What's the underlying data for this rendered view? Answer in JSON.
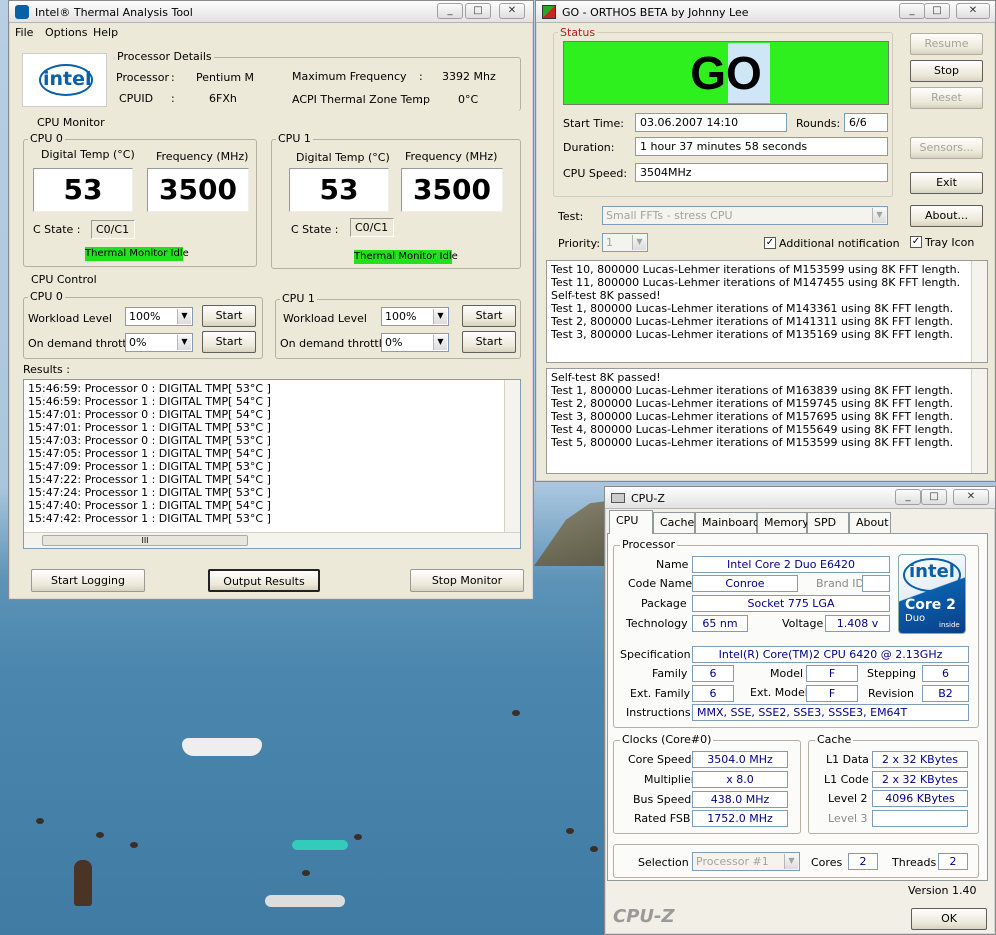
{
  "itat": {
    "title": "Intel® Thermal Analysis Tool",
    "menu": [
      "File",
      "Options",
      "Help"
    ],
    "processor_details_label": "Processor Details",
    "brand": "intel",
    "processor_label": "Processor",
    "processor_value": "Pentium M",
    "cpuid_label": "CPUID",
    "cpuid_value": "6FXh",
    "maxfreq_label": "Maximum Frequency",
    "maxfreq_value": "3392 Mhz",
    "acpi_label": "ACPI Thermal Zone Temp",
    "acpi_value": "0°C",
    "colon": ":",
    "cpu_monitor_label": "CPU Monitor",
    "cpus": [
      {
        "label": "CPU 0",
        "temp_label": "Digital Temp (°C)",
        "freq_label": "Frequency (MHz)",
        "temp": "53",
        "freq": "3500",
        "cstate_label": "C State  :",
        "cstate": "C0/C1",
        "status": "Thermal Monitor Idle"
      },
      {
        "label": "CPU 1",
        "temp_label": "Digital Temp (°C)",
        "freq_label": "Frequency (MHz)",
        "temp": "53",
        "freq": "3500",
        "cstate_label": "C State  :",
        "cstate": "C0/C1",
        "status": "Thermal Monitor Idle"
      }
    ],
    "cpu_control_label": "CPU Control",
    "controls": [
      {
        "label": "CPU 0",
        "workload_label": "Workload  Level",
        "workload": "100%",
        "throttle_label": "On demand throttle",
        "throttle": "0%",
        "start1": "Start",
        "start2": "Start"
      },
      {
        "label": "CPU 1",
        "workload_label": "Workload  Level",
        "workload": "100%",
        "throttle_label": "On demand throttle",
        "throttle": "0%",
        "start1": "Start",
        "start2": "Start"
      }
    ],
    "results_label": "Results :",
    "results": [
      "15:46:59: Processor 0 : DIGITAL TMP[ 53°C ]",
      "15:46:59: Processor 1 : DIGITAL TMP[ 54°C ]",
      "15:47:01: Processor 0 : DIGITAL TMP[ 54°C ]",
      "15:47:01: Processor 1 : DIGITAL TMP[ 53°C ]",
      "15:47:03: Processor 0 : DIGITAL TMP[ 53°C ]",
      "15:47:05: Processor 1 : DIGITAL TMP[ 54°C ]",
      "15:47:09: Processor 1 : DIGITAL TMP[ 53°C ]",
      "15:47:22: Processor 1 : DIGITAL TMP[ 54°C ]",
      "15:47:24: Processor 1 : DIGITAL TMP[ 53°C ]",
      "15:47:40: Processor 1 : DIGITAL TMP[ 54°C ]",
      "15:47:42: Processor 1 : DIGITAL TMP[ 53°C ]"
    ],
    "hscroll_grip": "III",
    "buttons": {
      "start_logging": "Start Logging",
      "output_results": "Output Results",
      "stop_monitor": "Stop Monitor"
    }
  },
  "orthos": {
    "title": "GO - ORTHOS BETA by Johnny Lee",
    "status_label": "Status",
    "status_text": "GO",
    "start_time_label": "Start Time:",
    "start_time": "03.06.2007 14:10",
    "rounds_label": "Rounds:",
    "rounds": "6/6",
    "duration_label": "Duration:",
    "duration": "1 hour 37 minutes 58 seconds",
    "cpu_speed_label": "CPU Speed:",
    "cpu_speed": "3504MHz",
    "buttons": {
      "resume": "Resume",
      "stop": "Stop",
      "reset": "Reset",
      "sensors": "Sensors...",
      "exit": "Exit",
      "about": "About..."
    },
    "test_label": "Test:",
    "test_value": "Small FFTs - stress CPU",
    "priority_label": "Priority:",
    "priority_value": "1",
    "additional_notification": "Additional notification",
    "tray_icon": "Tray Icon",
    "log1": [
      "Test 10, 800000 Lucas-Lehmer iterations of M153599 using 8K FFT length.",
      "Test 11, 800000 Lucas-Lehmer iterations of M147455 using 8K FFT length.",
      "Self-test 8K passed!",
      "Test 1, 800000 Lucas-Lehmer iterations of M143361 using 8K FFT length.",
      "Test 2, 800000 Lucas-Lehmer iterations of M141311 using 8K FFT length.",
      "Test 3, 800000 Lucas-Lehmer iterations of M135169 using 8K FFT length."
    ],
    "log2": [
      "Self-test 8K passed!",
      "Test 1, 800000 Lucas-Lehmer iterations of M163839 using 8K FFT length.",
      "Test 2, 800000 Lucas-Lehmer iterations of M159745 using 8K FFT length.",
      "Test 3, 800000 Lucas-Lehmer iterations of M157695 using 8K FFT length.",
      "Test 4, 800000 Lucas-Lehmer iterations of M155649 using 8K FFT length.",
      "Test 5, 800000 Lucas-Lehmer iterations of M153599 using 8K FFT length."
    ]
  },
  "cpuz": {
    "title": "CPU-Z",
    "tabs": [
      "CPU",
      "Cache",
      "Mainboard",
      "Memory",
      "SPD",
      "About"
    ],
    "processor_label": "Processor",
    "name_label": "Name",
    "name": "Intel Core 2 Duo E6420",
    "codename_label": "Code Name",
    "codename": "Conroe",
    "brandid_label": "Brand ID",
    "package_label": "Package",
    "package": "Socket 775 LGA",
    "technology_label": "Technology",
    "technology": "65 nm",
    "voltage_label": "Voltage",
    "voltage": "1.408 v",
    "spec_label": "Specification",
    "spec": "Intel(R) Core(TM)2 CPU         6420  @ 2.13GHz",
    "family_label": "Family",
    "family": "6",
    "model_label": "Model",
    "model": "F",
    "stepping_label": "Stepping",
    "stepping": "6",
    "extfamily_label": "Ext. Family",
    "extfamily": "6",
    "extmodel_label": "Ext. Model",
    "extmodel": "F",
    "revision_label": "Revision",
    "revision": "B2",
    "instructions_label": "Instructions",
    "instructions": "MMX, SSE, SSE2, SSE3, SSSE3, EM64T",
    "logo_intel": "intel",
    "logo_core": "Core 2",
    "logo_duo": "Duo",
    "logo_inside": "inside",
    "clocks_label": "Clocks (Core#0)",
    "core_speed_label": "Core Speed",
    "core_speed": "3504.0 MHz",
    "multiplier_label": "Multiplier",
    "multiplier": "x 8.0",
    "bus_speed_label": "Bus Speed",
    "bus_speed": "438.0 MHz",
    "rated_fsb_label": "Rated FSB",
    "rated_fsb": "1752.0 MHz",
    "cache_label": "Cache",
    "l1data_label": "L1 Data",
    "l1data": "2 x 32 KBytes",
    "l1code_label": "L1 Code",
    "l1code": "2 x 32 KBytes",
    "level2_label": "Level 2",
    "level2": "4096 KBytes",
    "level3_label": "Level 3",
    "selection_label": "Selection",
    "selection": "Processor #1",
    "cores_label": "Cores",
    "cores": "2",
    "threads_label": "Threads",
    "threads": "2",
    "version": "Version 1.40",
    "footer_brand": "CPU-Z",
    "ok": "OK"
  },
  "colors": {
    "green": "#22e01c",
    "go_bg": "#2ef01e",
    "go_highlight": "#cfe6f6",
    "intel_blue": "#0860a8"
  }
}
